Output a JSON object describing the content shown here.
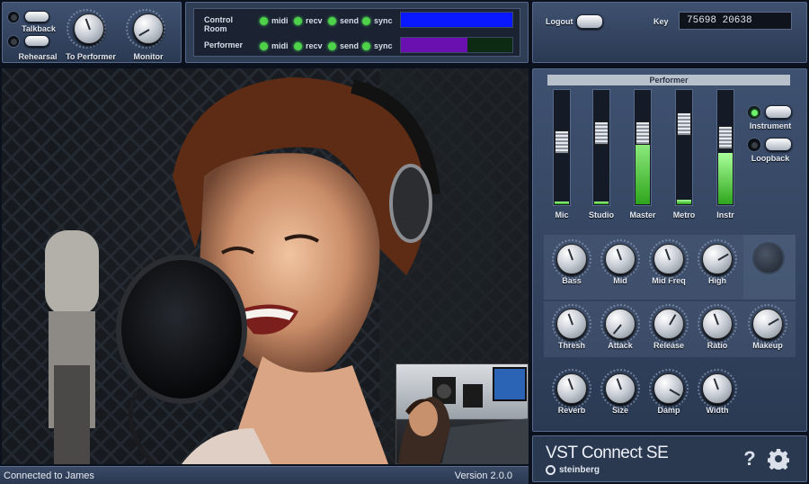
{
  "top_left": {
    "talkback_label": "Talkback",
    "rehearsal_label": "Rehearsal",
    "to_performer_label": "To Performer",
    "monitor_label": "Monitor",
    "knob_scale_min": "0",
    "knob_scale_max": "10"
  },
  "status_panel": {
    "rows": [
      {
        "name": "Control Room",
        "midi": "midi",
        "recv": "recv",
        "send": "send",
        "sync": "sync",
        "meter_level": 1.0,
        "meter_color": "#0a18ff"
      },
      {
        "name": "Performer",
        "midi": "midi",
        "recv": "recv",
        "send": "send",
        "sync": "sync",
        "meter_level": 0.6,
        "meter_color": "#6a10b0"
      }
    ]
  },
  "account": {
    "logout_label": "Logout",
    "key_label": "Key",
    "key_value": "75698 20638"
  },
  "performer": {
    "title": "Performer",
    "faders": [
      {
        "label": "Mic",
        "level": 0.02,
        "cap": 0.45
      },
      {
        "label": "Studio",
        "level": 0.02,
        "cap": 0.35
      },
      {
        "label": "Master",
        "level": 0.7,
        "cap": 0.35
      },
      {
        "label": "Metro",
        "level": 0.04,
        "cap": 0.25
      },
      {
        "label": "Instr",
        "level": 0.45,
        "cap": 0.4
      }
    ],
    "instrument_label": "Instrument",
    "loopback_label": "Loopback",
    "eq": [
      "Bass",
      "Mid",
      "Mid Freq",
      "High"
    ],
    "dyn": [
      "Thresh",
      "Attack",
      "Release",
      "Ratio",
      "Makeup"
    ],
    "reverb": [
      "Reverb",
      "Size",
      "Damp",
      "Width"
    ]
  },
  "brand": {
    "product": "VST Connect SE",
    "company": "steinberg"
  },
  "footer": {
    "status": "Connected to James",
    "version": "Version 2.0.0"
  }
}
